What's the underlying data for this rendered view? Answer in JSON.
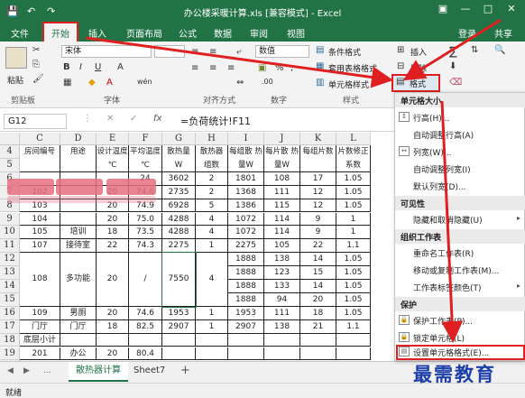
{
  "titlebar": {
    "qa_save": "💾",
    "qa_undo": "↶",
    "qa_redo": "↷",
    "title": "办公楼采暖计算.xls [兼容模式] - Excel",
    "min": "—",
    "max": "□",
    "close": "✕",
    "ribbon_opt": "▣"
  },
  "tabs": {
    "file": "文件",
    "home": "开始",
    "insert": "插入",
    "layout": "页面布局",
    "formulas": "公式",
    "data": "数据",
    "review": "审阅",
    "view": "视图",
    "login": "登录",
    "share": "共享"
  },
  "ribbon": {
    "paste_label": "粘贴",
    "clipboard": "剪贴板",
    "font_name": "宋体",
    "bold": "B",
    "italic": "I",
    "underline": "U",
    "font_group": "字体",
    "font_a": "A",
    "wen": "wén",
    "align_group": "对齐方式",
    "number_format": "数值",
    "percent": "%",
    "comma": ",",
    "number_group": "数字",
    "cond_format": "条件格式",
    "table_format": "套用表格格式",
    "cell_style": "单元格样式",
    "style_group": "样式",
    "insert_btn": "插入",
    "delete_btn": "删除",
    "format_btn": "格式",
    "sum_sym": "∑",
    "edit_group": "编辑"
  },
  "formula_bar": {
    "name_box": "G12",
    "formula": "=负荷统计!F11",
    "cancel": "✕",
    "confirm": "✓",
    "fx": "fx"
  },
  "columns": [
    "C",
    "D",
    "E",
    "F",
    "G",
    "H",
    "I",
    "J",
    "K",
    "L"
  ],
  "row_numbers": [
    "4",
    "5",
    "6",
    "7",
    "8",
    "9",
    "10",
    "11",
    "12",
    "13",
    "14",
    "15",
    "16",
    "17",
    "18",
    "19",
    "20"
  ],
  "header_cells": [
    "房间编号",
    "用途",
    "设计温度 ℃",
    "平均温度 ℃",
    "散热量 W",
    "散热器 组数",
    "每组散 热量W",
    "每片散 热量W",
    "每组片数",
    "片数修正 系数"
  ],
  "rows": [
    [
      "",
      "",
      "",
      "24",
      "3602",
      "2",
      "1801",
      "108",
      "17",
      "1.05"
    ],
    [
      "102",
      "",
      "20",
      "74.6",
      "2735",
      "2",
      "1368",
      "111",
      "12",
      "1.05"
    ],
    [
      "103",
      "",
      "20",
      "74.9",
      "6928",
      "5",
      "1386",
      "115",
      "12",
      "1.05"
    ],
    [
      "104",
      "",
      "20",
      "75.0",
      "4288",
      "4",
      "1072",
      "114",
      "9",
      "1"
    ],
    [
      "105",
      "培训",
      "18",
      "73.5",
      "4288",
      "4",
      "1072",
      "114",
      "9",
      "1"
    ],
    [
      "107",
      "接待室",
      "22",
      "74.3",
      "2275",
      "1",
      "2275",
      "105",
      "22",
      "1.1"
    ],
    [
      "",
      "",
      "",
      "",
      "",
      "",
      "1888",
      "138",
      "14",
      "1.05"
    ],
    [
      "108",
      "多功能",
      "20",
      "/",
      "7550",
      "4",
      "1888",
      "123",
      "15",
      "1.05"
    ],
    [
      "",
      "",
      "",
      "",
      "",
      "",
      "1888",
      "133",
      "14",
      "1.05"
    ],
    [
      "",
      "",
      "",
      "",
      "",
      "",
      "1888",
      "94",
      "20",
      "1.05"
    ],
    [
      "109",
      "男厕",
      "20",
      "74.6",
      "1953",
      "1",
      "1953",
      "111",
      "18",
      "1.05"
    ],
    [
      "门厅",
      "门厅",
      "18",
      "82.5",
      "2907",
      "1",
      "2907",
      "138",
      "21",
      "1.1"
    ],
    [
      "底层小计",
      "",
      "",
      "",
      "",
      "",
      "",
      "",
      "",
      ""
    ],
    [
      "201",
      "办公",
      "20",
      "80.4",
      "",
      "",
      "",
      "",
      "",
      ""
    ]
  ],
  "menu": {
    "size_head": "单元格大小",
    "row_height": "行高(H)...",
    "autofit_row": "自动调整行高(A)",
    "col_width": "列宽(W)...",
    "autofit_col": "自动调整列宽(I)",
    "default_width": "默认列宽(D)...",
    "vis_head": "可见性",
    "hide_unhide": "隐藏和取消隐藏(U)",
    "org_head": "组织工作表",
    "rename": "重命名工作表(R)",
    "move_copy": "移动或复制工作表(M)...",
    "tab_color": "工作表标签颜色(T)",
    "protect_head": "保护",
    "protect_sheet": "保护工作表(P)...",
    "lock_cell": "锁定单元格(L)",
    "format_cells": "设置单元格格式(E)..."
  },
  "sheets": {
    "active": "散热器计算",
    "other": "Sheet7",
    "add": "+",
    "nav_prev": "◀",
    "nav_next": "▶",
    "more": "..."
  },
  "status": {
    "ready": "就绪"
  },
  "watermark": "最需教育",
  "colors": {
    "excel_green": "#217346",
    "highlight_red": "#e02020",
    "watermark_blue": "#1c3fa8"
  }
}
